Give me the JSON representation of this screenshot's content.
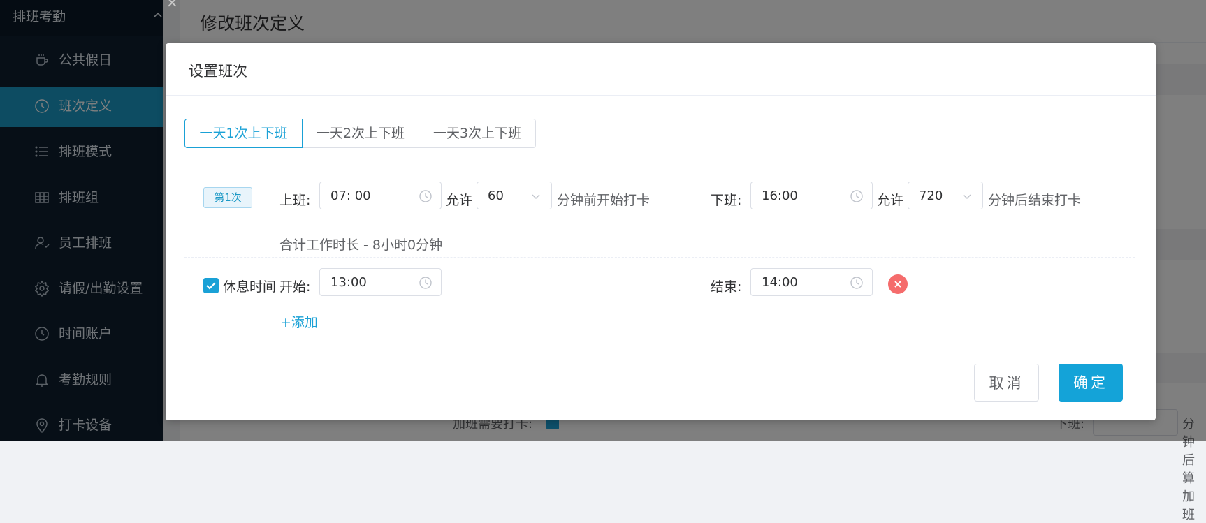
{
  "sidebar": {
    "group_title": "排班考勤",
    "items": [
      {
        "label": "公共假日",
        "icon": "cup-icon"
      },
      {
        "label": "班次定义",
        "icon": "clock-icon",
        "active": true
      },
      {
        "label": "排班模式",
        "icon": "list-icon"
      },
      {
        "label": "排班组",
        "icon": "grid-icon"
      },
      {
        "label": "员工排班",
        "icon": "user-icon"
      },
      {
        "label": "请假/出勤设置",
        "icon": "gear-icon"
      },
      {
        "label": "时间账户",
        "icon": "clock-icon"
      },
      {
        "label": "考勤规则",
        "icon": "bell-icon"
      },
      {
        "label": "打卡设备",
        "icon": "location-icon"
      }
    ]
  },
  "page": {
    "title": "修改班次定义",
    "overtime_label": "加班需要打卡:",
    "off_label": "下班:",
    "overtime_suffix": "分钟后算加班"
  },
  "dialog": {
    "title": "设置班次",
    "tabs": [
      {
        "label": "一天1次上下班",
        "active": true
      },
      {
        "label": "一天2次上下班"
      },
      {
        "label": "一天3次上下班"
      }
    ],
    "shift": {
      "badge": "第1次",
      "on_label": "上班:",
      "on_time": "07: 00",
      "allow_label": "允许",
      "before_minutes": "60",
      "before_suffix": "分钟前开始打卡",
      "off_label": "下班:",
      "off_time": "16:00",
      "after_minutes": "720",
      "after_suffix": "分钟后结束打卡",
      "total": "合计工作时长 - 8小时0分钟"
    },
    "break": {
      "checked": true,
      "label": "休息时间",
      "start_label": "开始:",
      "start_time": "13:00",
      "end_label": "结束:",
      "end_time": "14:00"
    },
    "add_label": "+添加",
    "cancel_label": "取消",
    "confirm_label": "确定"
  },
  "colors": {
    "accent": "#1aa1d6",
    "sidebar_bg": "#0e1f2f",
    "danger": "#f56c6c"
  }
}
